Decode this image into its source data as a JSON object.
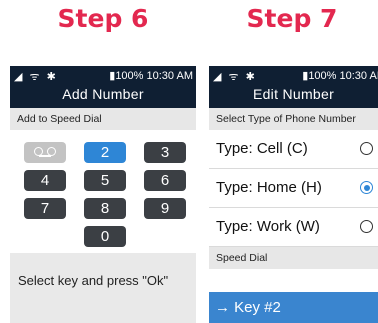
{
  "steps": {
    "left": "Step 6",
    "right": "Step 7"
  },
  "status": {
    "signal_icons": "◢ ᯤ ✱",
    "battery": "▮100%",
    "time": "10:30 AM"
  },
  "add_number": {
    "title": "Add Number",
    "subtitle": "Add to Speed Dial",
    "keys": [
      "2",
      "3",
      "4",
      "5",
      "6",
      "7",
      "8",
      "9",
      "0"
    ],
    "voicemail_icon": "voicemail-icon",
    "selected_key": "2",
    "instruction": "Select key and press \"Ok\""
  },
  "edit_number": {
    "title": "Edit Number",
    "subtitle": "Select Type of Phone Number",
    "types": [
      {
        "label": "Type: Cell (C)",
        "selected": false
      },
      {
        "label": "Type: Home (H)",
        "selected": true
      },
      {
        "label": "Type: Work (W)",
        "selected": false
      }
    ],
    "speed_dial_header": "Speed Dial",
    "speed_dial_value": "→ Key #2"
  },
  "colors": {
    "accent": "#e3284f",
    "header_bg": "#0f1f33",
    "selected_blue": "#2e86d6"
  }
}
